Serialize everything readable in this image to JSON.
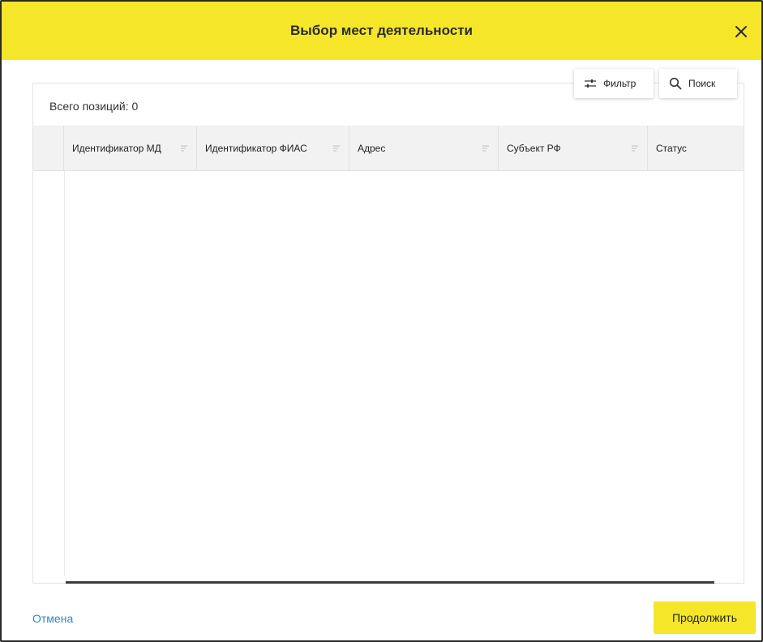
{
  "dialog": {
    "title": "Выбор мест деятельности",
    "header_color": "#f5e62a"
  },
  "panel": {
    "total_label": "Всего позиций: 0"
  },
  "toolbar": {
    "filter_label": "Фильтр",
    "search_label": "Поиск"
  },
  "table": {
    "columns": [
      {
        "label": "Идентификатор МД",
        "sortable": true
      },
      {
        "label": "Идентификатор ФИАС",
        "sortable": true
      },
      {
        "label": "Адрес",
        "sortable": true
      },
      {
        "label": "Субъект РФ",
        "sortable": true
      },
      {
        "label": "Статус",
        "sortable": false
      }
    ],
    "rows": []
  },
  "footer": {
    "cancel_label": "Отмена",
    "continue_label": "Продолжить",
    "link_color": "#2e88c7"
  },
  "icons": {
    "close": "close-icon",
    "filter": "sliders-icon",
    "search": "magnifier-icon",
    "sort": "sort-icon"
  }
}
